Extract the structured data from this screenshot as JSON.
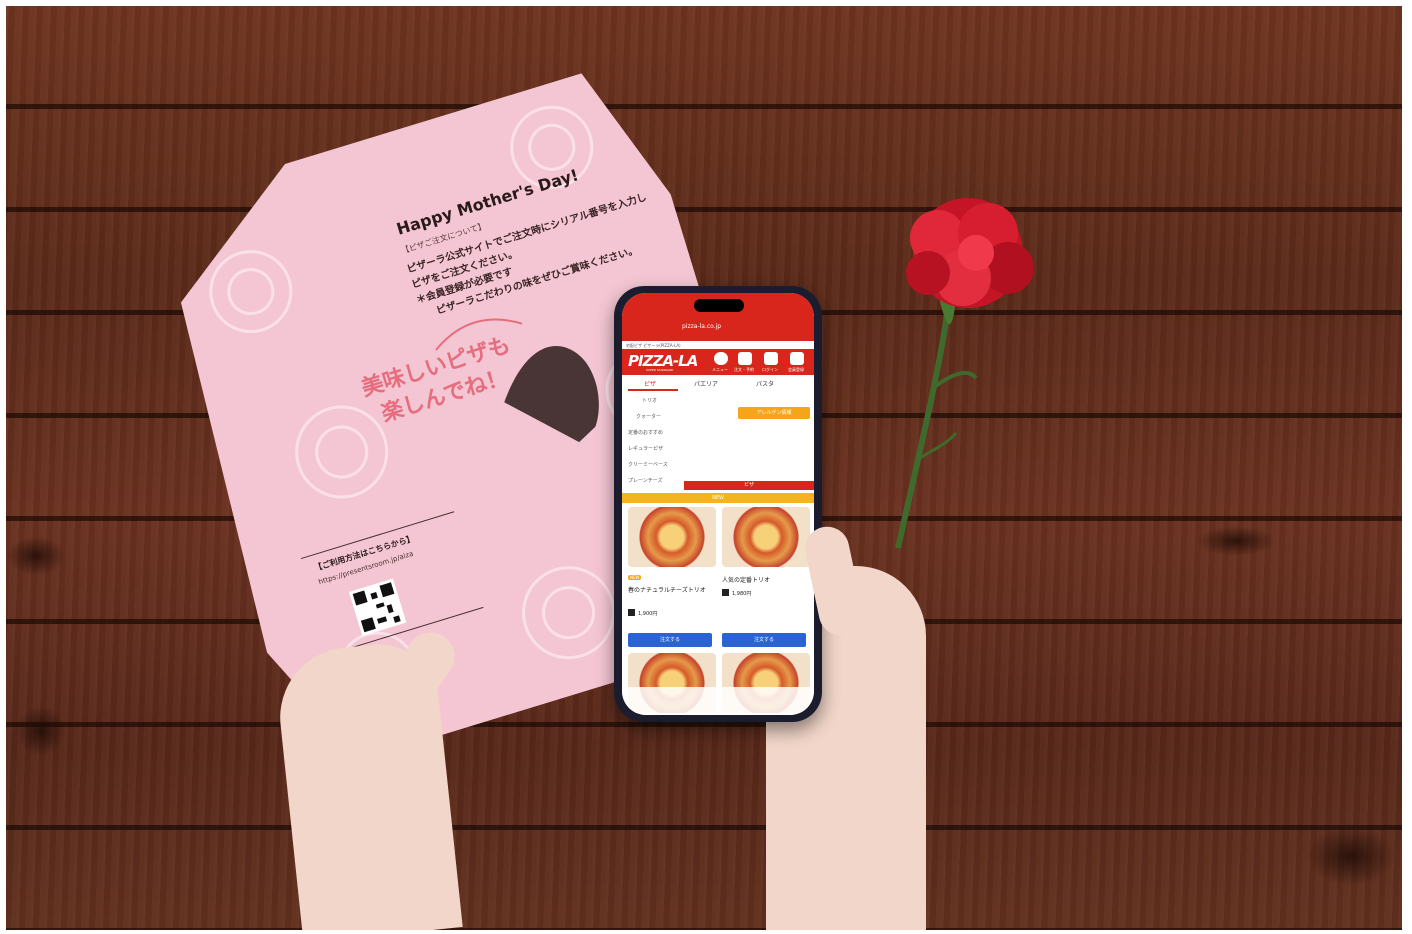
{
  "card": {
    "title": "Happy Mother's Day!",
    "sub": "【ピザご注文について】",
    "line1": "ピザーラ公式サイトでご注文時にシリアル番号を入力し",
    "line2": "ピザをご注文ください。",
    "line3": "＊会員登録が必要です",
    "line4": "ピザーラこだわりの味をぜひご賞味ください。",
    "message_1": "美味しいピザも",
    "message_2": "楽しんでね！",
    "inquiry": "【ご利用方法はこちらから】",
    "url": "https://presentsroom.jp/aiza"
  },
  "phone": {
    "address": "pizza-la.co.jp",
    "breadcrumb": "宅配ピザ ピザーラ(PIZZA-LA)",
    "logo": "PIZZA-LA",
    "logo_sub": "SUPER STANDARD",
    "nav": [
      "メニュー",
      "注文・予約",
      "ログイン",
      "会員登録"
    ],
    "tabs": [
      "ピザ",
      "パエリア",
      "パスタ"
    ],
    "menu": [
      "トリオ",
      "クォーター",
      "定番のおすすめ",
      "レギュラーピザ",
      "クリーミーベース",
      "プレーンチーズ"
    ],
    "allergy_button": "アレルゲン情報",
    "category_bar": "ピザ",
    "new_bar": "NEW",
    "new_badge": "NEW",
    "products": [
      {
        "name": "春のナチュラルチーズトリオ",
        "price": "1,900円",
        "button": "注文する"
      },
      {
        "name": "人気の定番トリオ",
        "price": "1,980円",
        "button": "注文する"
      }
    ]
  },
  "colors": {
    "card_pink": "#f4c6d3",
    "pizza_red": "#d9261c",
    "order_blue": "#2b63d5",
    "carnation": "#d21a2a"
  }
}
